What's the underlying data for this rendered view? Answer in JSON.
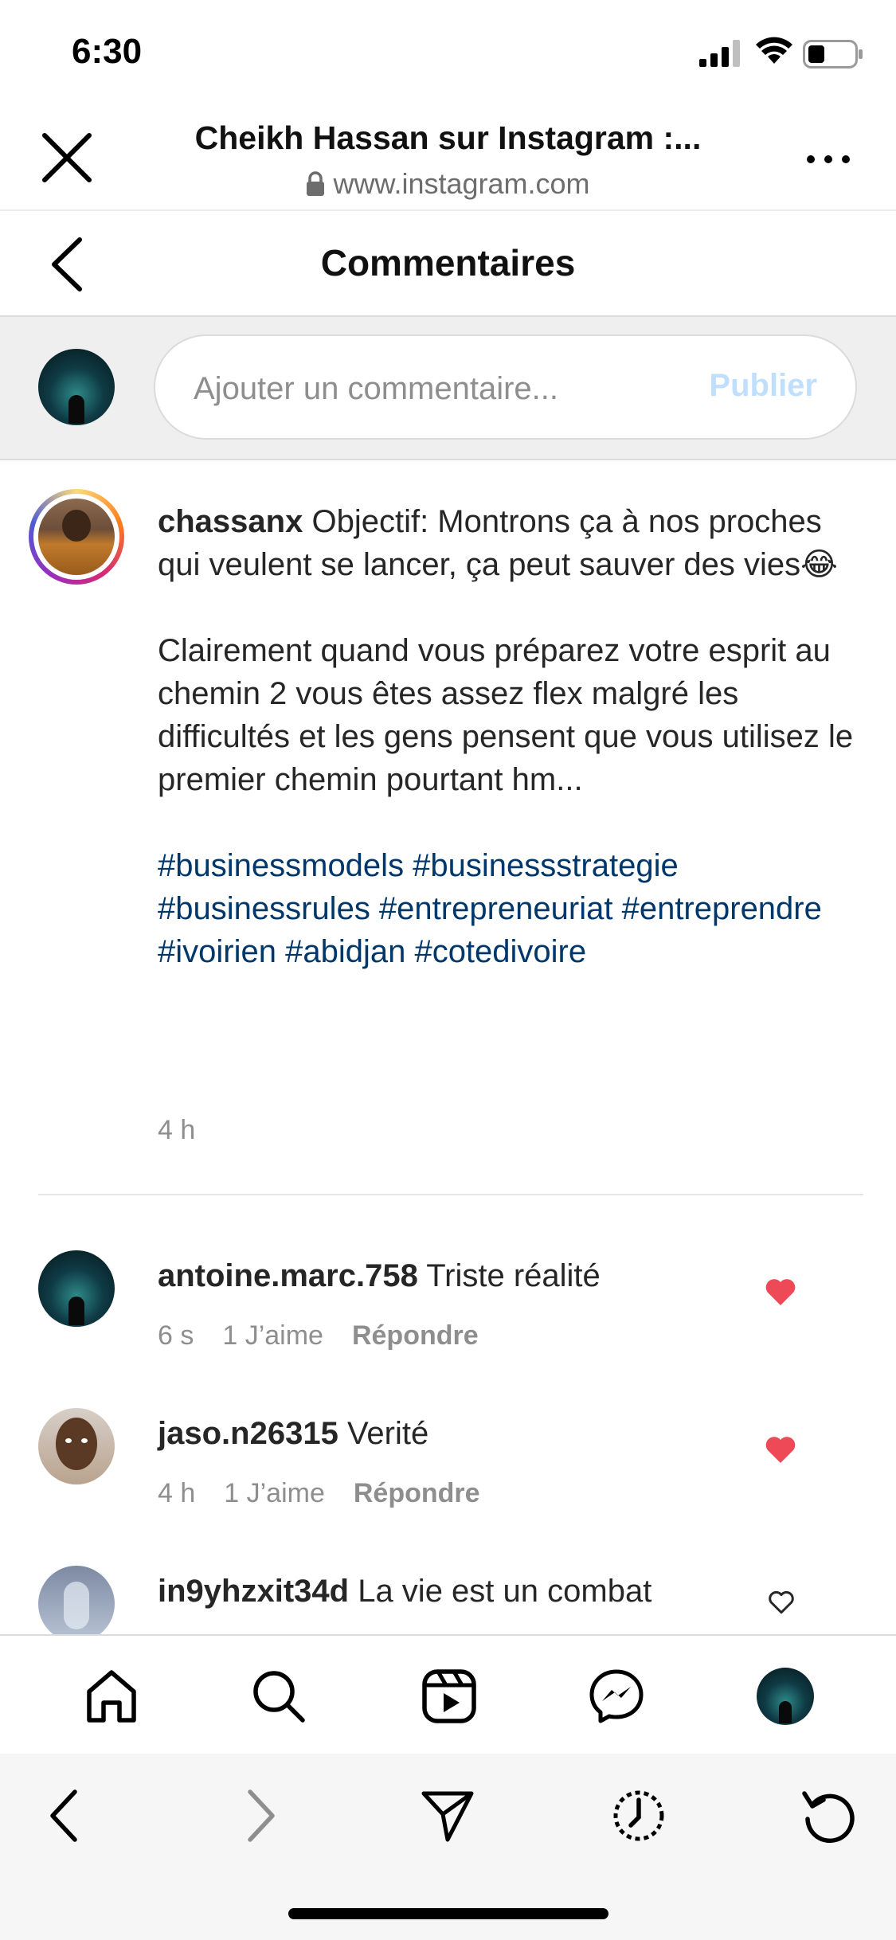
{
  "status_bar": {
    "time": "6:30"
  },
  "browser": {
    "title": "Cheikh Hassan sur Instagram :...",
    "url": "www.instagram.com"
  },
  "comments_header": {
    "title": "Commentaires"
  },
  "add_comment": {
    "placeholder": "Ajouter un commentaire...",
    "publish_label": "Publier"
  },
  "caption": {
    "username": "chassanx",
    "line1": "Objectif: Montrons ça à nos proches qui veulent se lancer, ça peut sauver des vies😂",
    "line2": "Clairement quand vous préparez votre esprit au chemin 2 vous êtes assez flex malgré les difficultés et les gens pensent que vous utilisez le premier chemin pourtant hm...",
    "hashtags": "#businessmodels #businessstrategie #businessrules #entrepreneuriat #entreprendre #ivoirien #abidjan #cotedivoire",
    "time": "4 h"
  },
  "comments": [
    {
      "username": "antoine.marc.758",
      "text": "Triste réalité",
      "time": "6 s",
      "likes": "1 J’aime",
      "reply": "Répondre",
      "liked": true
    },
    {
      "username": "jaso.n26315",
      "text": "Verité",
      "time": "4 h",
      "likes": "1 J’aime",
      "reply": "Répondre",
      "liked": true
    },
    {
      "username": "in9yhzxit34d",
      "text": "La vie est un combat",
      "liked": false
    }
  ],
  "colors": {
    "like_red": "#ed4956",
    "hashtag_blue": "#00376b",
    "publish_disabled": "#c0dffd",
    "meta_grey": "#8e8e8e"
  },
  "icons": {
    "nav": [
      "home-icon",
      "search-icon",
      "reels-icon",
      "messenger-icon",
      "profile-avatar"
    ],
    "toolbar": [
      "back-arrow-icon",
      "forward-arrow-icon",
      "share-send-icon",
      "history-icon",
      "reload-icon"
    ]
  }
}
